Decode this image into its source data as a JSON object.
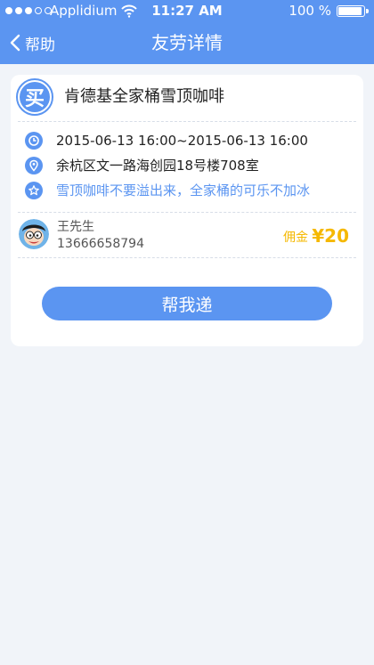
{
  "status_bar": {
    "carrier": "Applidium",
    "time": "11:27 AM",
    "battery": "100 %"
  },
  "nav": {
    "back_label": "帮助",
    "title": "友劳详情"
  },
  "task": {
    "badge": "买",
    "name": "肯德基全家桶雪顶咖啡",
    "time_range": "2015-06-13  16:00~2015-06-13  16:00",
    "address": "余杭区文一路海创园18号楼708室",
    "note": "雪顶咖啡不要溢出来，全家桶的可乐不加冰"
  },
  "requester": {
    "name": "王先生",
    "phone": "13666658794",
    "fee_label": "佣金",
    "fee_value": "¥20"
  },
  "action": {
    "help_label": "帮我递"
  },
  "colors": {
    "accent": "#5b95f1",
    "fee": "#f5b800",
    "background": "#f1f4f9"
  },
  "icons": [
    "wifi-icon",
    "battery-icon",
    "back-chevron-icon",
    "clock-icon",
    "location-icon",
    "star-icon"
  ]
}
